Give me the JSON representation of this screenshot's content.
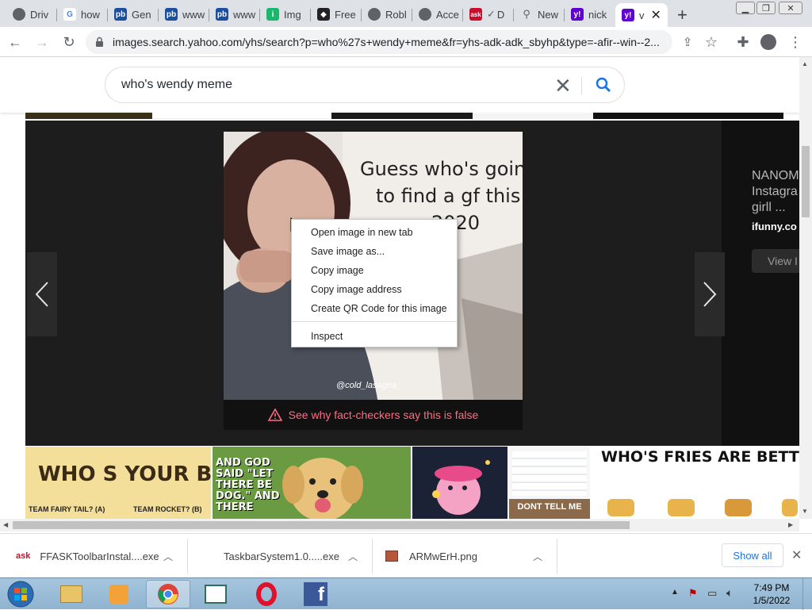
{
  "tabs": [
    {
      "label": "Driv",
      "favicon": "chrome-icon"
    },
    {
      "label": "how",
      "favicon": "google-icon"
    },
    {
      "label": "Gen",
      "favicon": "photobucket-icon"
    },
    {
      "label": "www",
      "favicon": "photobucket-icon"
    },
    {
      "label": "www",
      "favicon": "photobucket-icon"
    },
    {
      "label": "Img",
      "favicon": "imgur-icon"
    },
    {
      "label": "Free",
      "favicon": "roblox-icon"
    },
    {
      "label": "Robl",
      "favicon": "chrome-icon"
    },
    {
      "label": "Acce",
      "favicon": "chrome-icon"
    },
    {
      "label": "D",
      "favicon": "ask-icon"
    },
    {
      "label": "New",
      "favicon": "search-icon"
    },
    {
      "label": "nick",
      "favicon": "yahoo-icon"
    },
    {
      "label": "v",
      "favicon": "yahoo-icon"
    }
  ],
  "address": {
    "url": "images.search.yahoo.com/yhs/search?p=who%27s+wendy+meme&fr=yhs-adk-adk_sbyhp&type=-afir--win--2..."
  },
  "search": {
    "query": "who's wendy meme"
  },
  "viewer": {
    "meme_text_line1": "Guess who's going",
    "meme_text_line2": "to find a gf this",
    "meme_text_line3": "2020",
    "watermark": "@cold_lasagna_",
    "fact_check": "See why fact-checkers say this is false",
    "side_title1": "NANOM",
    "side_title2": "Instagra",
    "side_title3": "girll ...",
    "side_source": "ifunny.co",
    "side_button": "View I"
  },
  "context_menu": {
    "open_new_tab": "Open image in new tab",
    "save_as": "Save image as...",
    "copy_image": "Copy image",
    "copy_address": "Copy image address",
    "qr_code": "Create QR Code for this image",
    "inspect": "Inspect"
  },
  "thumbnails": {
    "t1_title": "WHO S YOUR BET?",
    "t1_left": "TEAM FAIRY TAIL? (A)",
    "t1_right": "TEAM ROCKET? (B)",
    "t2_line1": "AND GOD",
    "t2_line2": "SAID \"LET",
    "t2_line3": "THERE BE",
    "t2_line4": "DOG.\" AND",
    "t2_line5": "THERE",
    "t3_caption": "DONT TELL ME",
    "t4_title": "WHO'S FRIES ARE BETT"
  },
  "downloads": {
    "item1": "FFASKToolbarInstal....exe",
    "item2": "TaskbarSystem1.0.....exe",
    "item3": "ARMwErH.png",
    "show_all": "Show all"
  },
  "taskbar": {
    "time": "7:49 PM",
    "date": "1/5/2022"
  },
  "colors": {
    "yahoo_purple": "#6001d2",
    "fact_pink": "#ff6b82",
    "link_blue": "#1a73e8"
  }
}
